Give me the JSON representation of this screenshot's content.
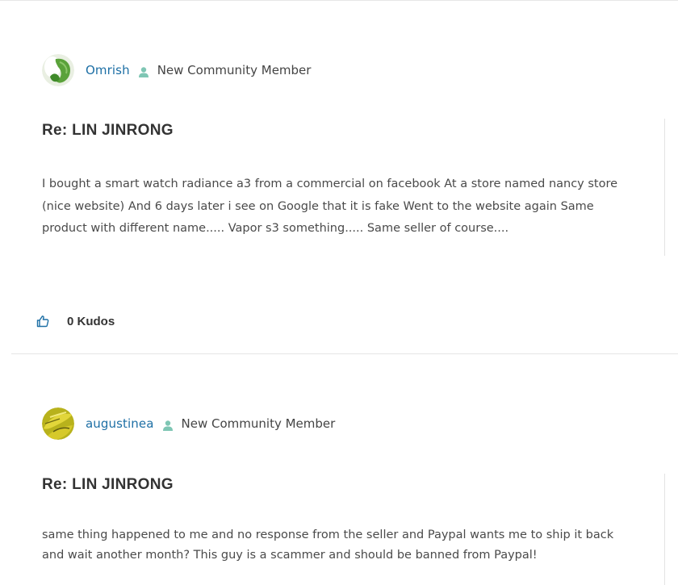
{
  "posts": [
    {
      "author": "Omrish",
      "rank": "New Community Member",
      "subject": "Re: LIN JINRONG",
      "body": "I bought a smart watch radiance a3 from a commercial on facebook At a store named nancy store (nice website) And 6 days later i see on Google that it is fake Went to the website again Same product with different name..... Vapor s3 something..... Same seller of course....",
      "kudos": "0 Kudos"
    },
    {
      "author": "augustinea",
      "rank": "New Community Member",
      "subject": "Re: LIN JINRONG",
      "body": "same thing happened to me and no response from the seller and Paypal wants me to ship it back and wait another month? This guy is a scammer and should be banned from Paypal!"
    }
  ],
  "colors": {
    "link": "#1d6fa5",
    "rank_icon": "#7fc6b4",
    "kudos_icon": "#1d6fa5"
  },
  "icons": {
    "rank": "member-rank-icon",
    "kudos": "thumbs-up-icon"
  }
}
